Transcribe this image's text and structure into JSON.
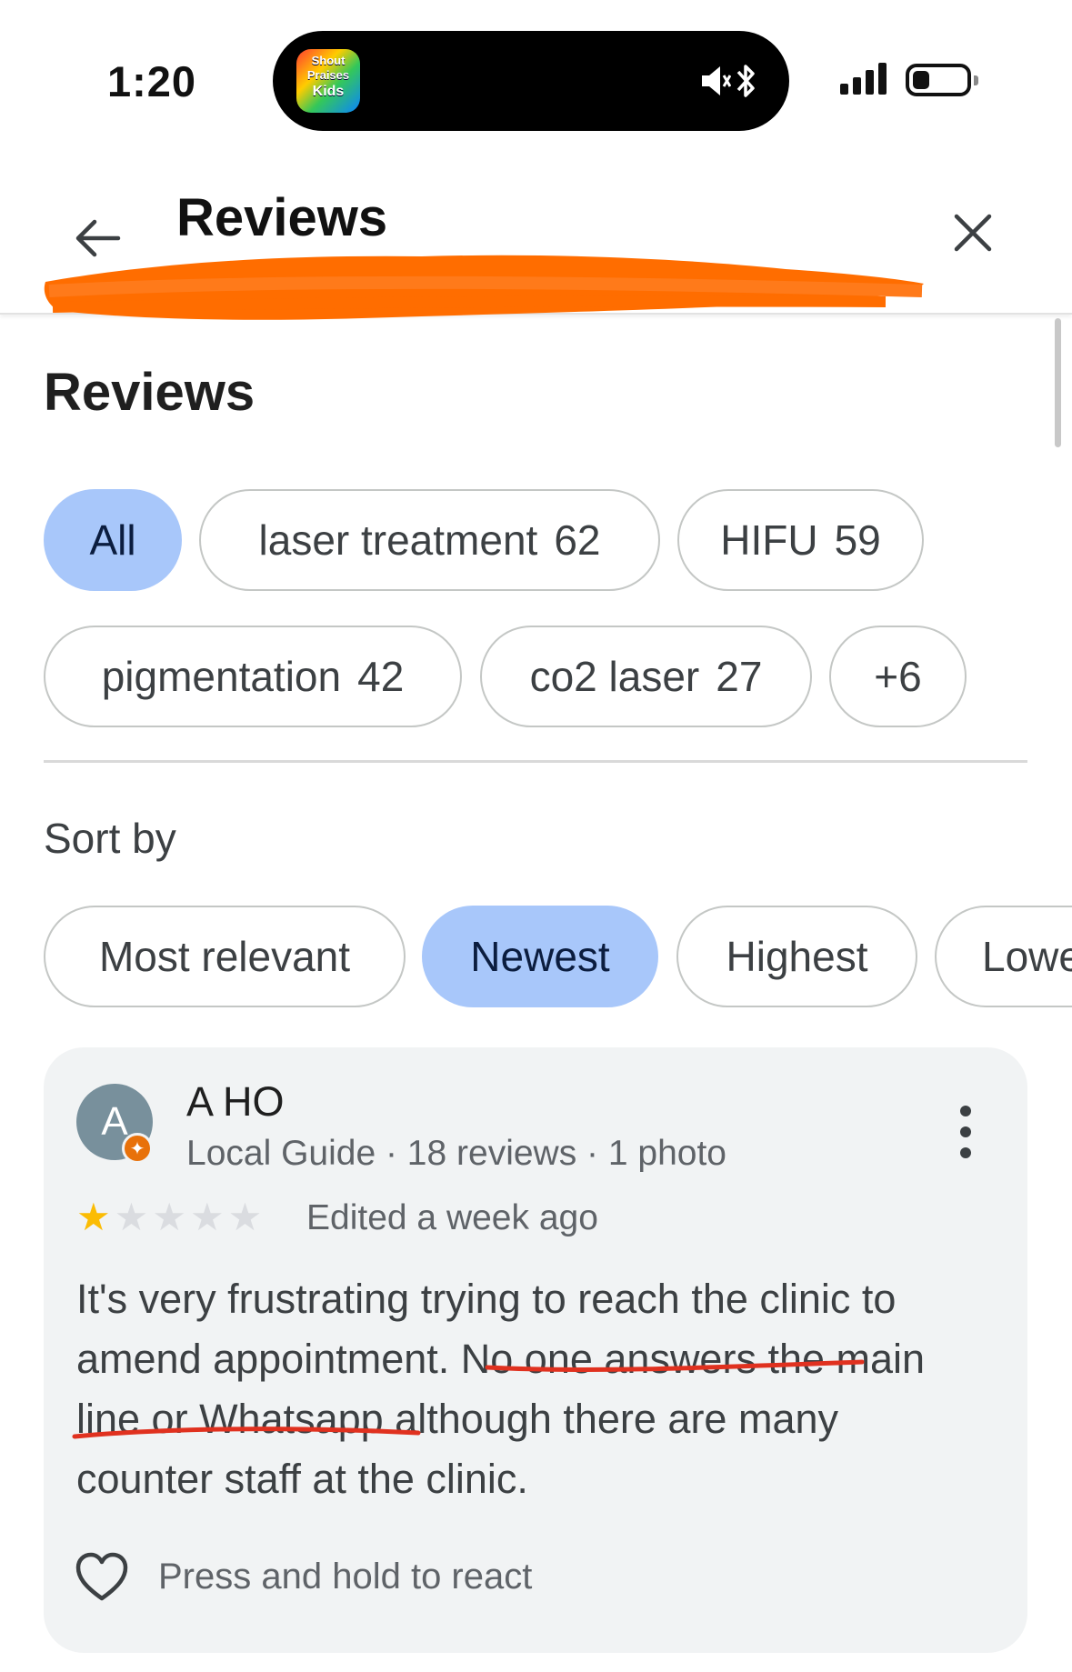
{
  "status_bar": {
    "time": "1:20",
    "app_icon_text": [
      "Shout",
      "Praises",
      "Kids"
    ],
    "icons": [
      "speaker-mute-icon",
      "bluetooth-icon",
      "signal-icon",
      "battery-icon"
    ]
  },
  "header": {
    "title": "Reviews",
    "back_icon": "arrow-left-icon",
    "close_icon": "close-icon",
    "subtitle_redacted": true,
    "redaction_color": "#ff6d00"
  },
  "section": {
    "title": "Reviews"
  },
  "topic_chips": [
    {
      "label": "All",
      "count": "",
      "selected": true
    },
    {
      "label": "laser treatment",
      "count": "62",
      "selected": false
    },
    {
      "label": "HIFU",
      "count": "59",
      "selected": false
    },
    {
      "label": "pigmentation",
      "count": "42",
      "selected": false
    },
    {
      "label": "co2 laser",
      "count": "27",
      "selected": false
    },
    {
      "label": "+6",
      "count": "",
      "selected": false
    }
  ],
  "sort": {
    "label": "Sort by",
    "options": [
      {
        "label": "Most relevant",
        "selected": false
      },
      {
        "label": "Newest",
        "selected": true
      },
      {
        "label": "Highest",
        "selected": false
      },
      {
        "label": "Lowe",
        "selected": false
      }
    ]
  },
  "review": {
    "avatar_letter": "A",
    "avatar_color": "#78909c",
    "name": "A HO",
    "meta": "Local Guide · 18 reviews · 1 photo",
    "rating": 1,
    "rating_max": 5,
    "edited": "Edited a week ago",
    "text_lines": [
      "It's very frustrating trying to reach the clinic to",
      "amend appointment. No one answers the main",
      "line or Whatsapp although there are many",
      "counter staff at the clinic."
    ],
    "react_label": "Press and hold to react",
    "underline_color": "#e0311f"
  },
  "colors": {
    "chip_selected_bg": "#a8c7fa",
    "star_on": "#fbbc04",
    "card_bg": "#f1f3f4"
  }
}
